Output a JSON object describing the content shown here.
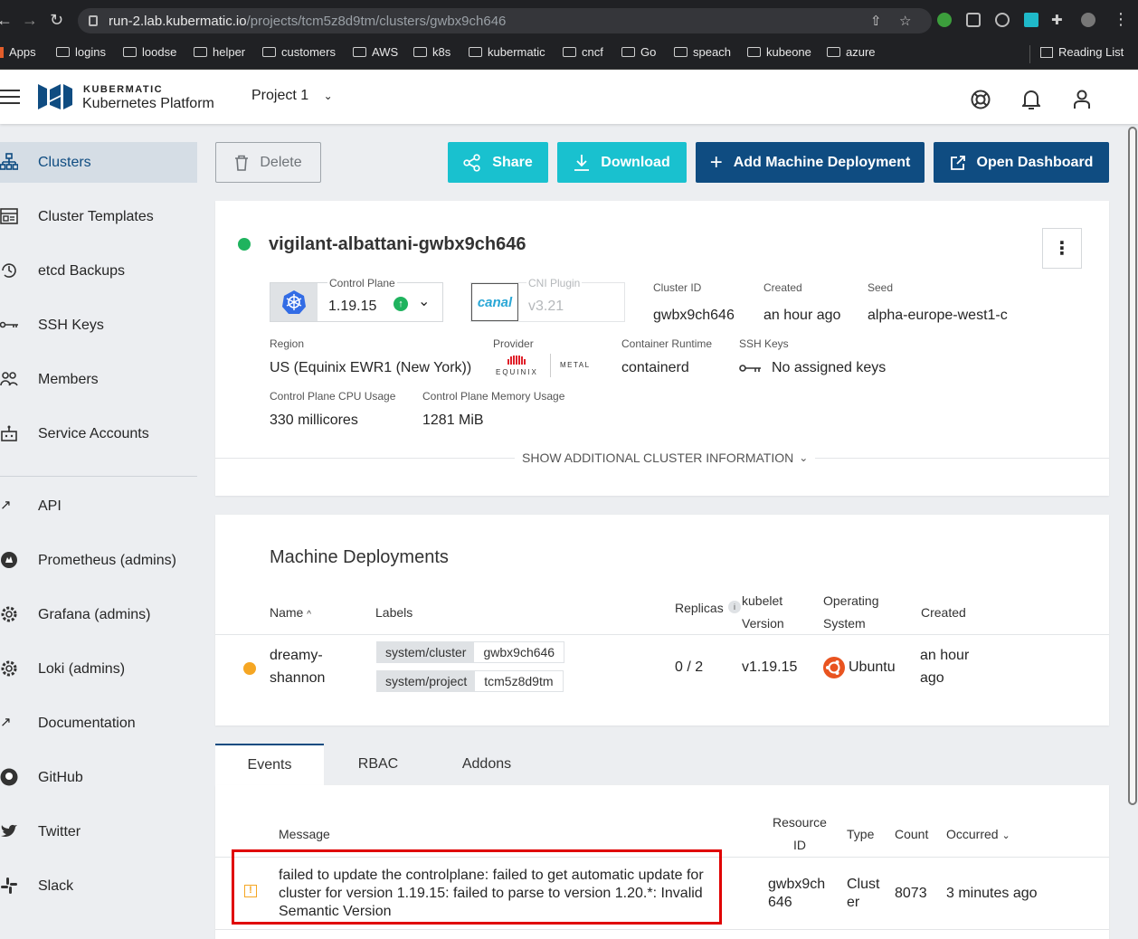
{
  "browser": {
    "url_host": "run-2.lab.kubermatic.io",
    "url_path": "/projects/tcm5z8d9tm/clusters/gwbx9ch646",
    "bookmarks": [
      "Apps",
      "logins",
      "loodse",
      "helper",
      "customers",
      "AWS",
      "k8s",
      "kubermatic",
      "cncf",
      "Go",
      "speach",
      "kubeone",
      "azure"
    ],
    "reading_list": "Reading List"
  },
  "header": {
    "brand_top": "KUBERMATIC",
    "brand_bottom": "Kubernetes Platform",
    "project": "Project 1"
  },
  "sidebar": {
    "items": [
      "Clusters",
      "Cluster Templates",
      "etcd Backups",
      "SSH Keys",
      "Members",
      "Service Accounts"
    ],
    "links": [
      "API",
      "Prometheus (admins)",
      "Grafana (admins)",
      "Loki (admins)",
      "Documentation",
      "GitHub",
      "Twitter",
      "Slack"
    ]
  },
  "toolbar": {
    "delete": "Delete",
    "share": "Share",
    "download": "Download",
    "add_md": "Add Machine Deployment",
    "open_dashboard": "Open Dashboard"
  },
  "cluster": {
    "name": "vigilant-albattani-gwbx9ch646",
    "control_plane_label": "Control Plane",
    "control_plane_version": "1.19.15",
    "cni_label": "CNI Plugin",
    "cni_logo": "canal",
    "cni_version": "v3.21",
    "cluster_id_label": "Cluster ID",
    "cluster_id": "gwbx9ch646",
    "created_label": "Created",
    "created": "an hour ago",
    "seed_label": "Seed",
    "seed": "alpha-europe-west1-c",
    "region_label": "Region",
    "region": "US (Equinix EWR1 (New York))",
    "provider_label": "Provider",
    "provider_logo_main": "EQUINIX",
    "provider_logo_sub": "METAL",
    "runtime_label": "Container Runtime",
    "runtime": "containerd",
    "ssh_label": "SSH Keys",
    "ssh": "No assigned keys",
    "cpu_label": "Control Plane CPU Usage",
    "cpu": "330 millicores",
    "mem_label": "Control Plane Memory Usage",
    "mem": "1281 MiB",
    "show_more": "SHOW ADDITIONAL CLUSTER INFORMATION",
    "status_color": "#1fb35e"
  },
  "machine_deployments": {
    "title": "Machine Deployments",
    "headers": {
      "name": "Name",
      "labels": "Labels",
      "replicas": "Replicas",
      "kubelet_1": "kubelet",
      "kubelet_2": "Version",
      "os_1": "Operating",
      "os_2": "System",
      "created": "Created"
    },
    "row": {
      "name_1": "dreamy-",
      "name_2": "shannon",
      "label1_key": "system/cluster",
      "label1_val": "gwbx9ch646",
      "label2_key": "system/project",
      "label2_val": "tcm5z8d9tm",
      "replicas": "0 / 2",
      "kubelet": "v1.19.15",
      "os": "Ubuntu",
      "created_1": "an hour",
      "created_2": "ago",
      "status_color": "#f5a623"
    }
  },
  "tabs": [
    "Events",
    "RBAC",
    "Addons"
  ],
  "events": {
    "headers": {
      "message": "Message",
      "resource_1": "Resource",
      "resource_2": "ID",
      "type": "Type",
      "count": "Count",
      "occurred": "Occurred"
    },
    "row": {
      "msg_1": "failed to update the controlplane: failed to get automatic update for",
      "msg_2": "cluster for version 1.19.15: failed to parse to version 1.20.*: Invalid",
      "msg_3": "Semantic Version",
      "resource_1": "gwbx9ch",
      "resource_2": "646",
      "type_1": "Clust",
      "type_2": "er",
      "count": "8073",
      "occurred": "3 minutes ago",
      "highlight_color": "#e00000",
      "warn_color": "#f5a623"
    }
  }
}
